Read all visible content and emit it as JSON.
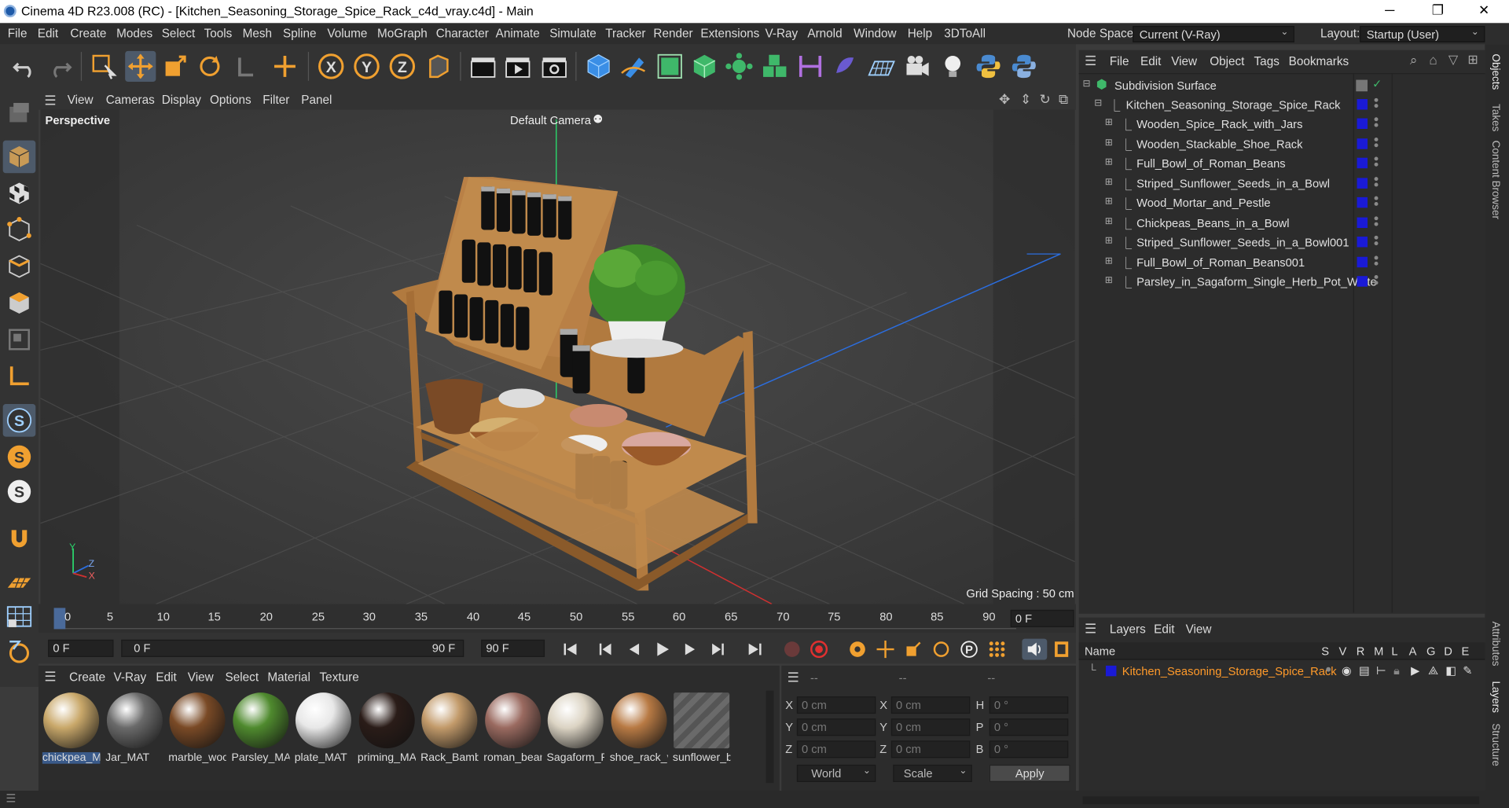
{
  "window": {
    "title": "Cinema 4D R23.008 (RC) - [Kitchen_Seasoning_Storage_Spice_Rack_c4d_vray.c4d] - Main",
    "minimize": "─",
    "maximize": "❐",
    "close": "✕"
  },
  "menubar": {
    "items": [
      "File",
      "Edit",
      "Create",
      "Modes",
      "Select",
      "Tools",
      "Mesh",
      "Spline",
      "Volume",
      "MoGraph",
      "Character",
      "Animate",
      "Simulate",
      "Tracker",
      "Render",
      "Extensions",
      "V-Ray",
      "Arnold",
      "Window",
      "Help",
      "3DToAll"
    ],
    "node_space_label": "Node Space:",
    "node_space_value": "Current (V-Ray)",
    "layout_label": "Layout:",
    "layout_value": "Startup (User)"
  },
  "viewport": {
    "menu": [
      "View",
      "Cameras",
      "Display",
      "Options",
      "Filter",
      "Panel"
    ],
    "view_name": "Perspective",
    "camera_label": "Default Camera",
    "grid_spacing": "Grid Spacing : 50 cm",
    "axis_x": "X",
    "axis_y": "Y",
    "axis_z": "Z"
  },
  "timeline": {
    "ticks": [
      "0",
      "5",
      "10",
      "15",
      "20",
      "25",
      "30",
      "35",
      "40",
      "45",
      "50",
      "55",
      "60",
      "65",
      "70",
      "75",
      "80",
      "85",
      "90"
    ],
    "current_frame": "0 F"
  },
  "transport": {
    "start_field": "0 F",
    "range_start": "0 F",
    "range_end": "90 F",
    "end_field": "90 F"
  },
  "materials": {
    "menu": [
      "Create",
      "V-Ray",
      "Edit",
      "View",
      "Select",
      "Material",
      "Texture"
    ],
    "items": [
      {
        "name": "chickpea_M",
        "color": "#c9a86a"
      },
      {
        "name": "Jar_MAT",
        "color": "#6a6a6a"
      },
      {
        "name": "marble_woc",
        "color": "#7a4a26"
      },
      {
        "name": "Parsley_MA",
        "color": "#4f8a2e"
      },
      {
        "name": "plate_MAT",
        "color": "#e8e8e8"
      },
      {
        "name": "priming_MA",
        "color": "#2a1c18"
      },
      {
        "name": "Rack_Bamb",
        "color": "#c29a6a"
      },
      {
        "name": "roman_bear",
        "color": "#9a6a60"
      },
      {
        "name": "Sagaform_P",
        "color": "#dcd4c4"
      },
      {
        "name": "shoe_rack_v",
        "color": "#b87a44"
      },
      {
        "name": "sunflower_b",
        "color": "#5a5a5a"
      }
    ]
  },
  "coords": {
    "header": [
      "--",
      "--",
      "--"
    ],
    "rows": [
      {
        "a": "X",
        "av": "0 cm",
        "b": "X",
        "bv": "0 cm",
        "c": "H",
        "cv": "0 °"
      },
      {
        "a": "Y",
        "av": "0 cm",
        "b": "Y",
        "bv": "0 cm",
        "c": "P",
        "cv": "0 °"
      },
      {
        "a": "Z",
        "av": "0 cm",
        "b": "Z",
        "bv": "0 cm",
        "c": "B",
        "cv": "0 °"
      }
    ],
    "world": "World",
    "scale": "Scale",
    "apply": "Apply"
  },
  "objects": {
    "menu": [
      "File",
      "Edit",
      "View",
      "Object",
      "Tags",
      "Bookmarks"
    ],
    "root": "Subdivision Surface",
    "group": "Kitchen_Seasoning_Storage_Spice_Rack",
    "children": [
      "Wooden_Spice_Rack_with_Jars",
      "Wooden_Stackable_Shoe_Rack",
      "Full_Bowl_of_Roman_Beans",
      "Striped_Sunflower_Seeds_in_a_Bowl",
      "Wood_Mortar_and_Pestle",
      "Chickpeas_Beans_in_a_Bowl",
      "Striped_Sunflower_Seeds_in_a_Bowl001",
      "Full_Bowl_of_Roman_Beans001",
      "Parsley_in_Sagaform_Single_Herb_Pot_White"
    ]
  },
  "layers": {
    "menu": [
      "Layers",
      "Edit",
      "View"
    ],
    "name_col": "Name",
    "flag_cols": [
      "S",
      "V",
      "R",
      "M",
      "L",
      "A",
      "G",
      "D",
      "E"
    ],
    "layer_name": "Kitchen_Seasoning_Storage_Spice_Rack"
  },
  "right_tabs": [
    "Objects",
    "Takes",
    "Content Browser",
    "Attributes",
    "Layers",
    "Structure"
  ],
  "colors": {
    "accent": "#3a8ee6",
    "layer_orange": "#ff9a2a",
    "object_blue": "#1a1ad6"
  }
}
